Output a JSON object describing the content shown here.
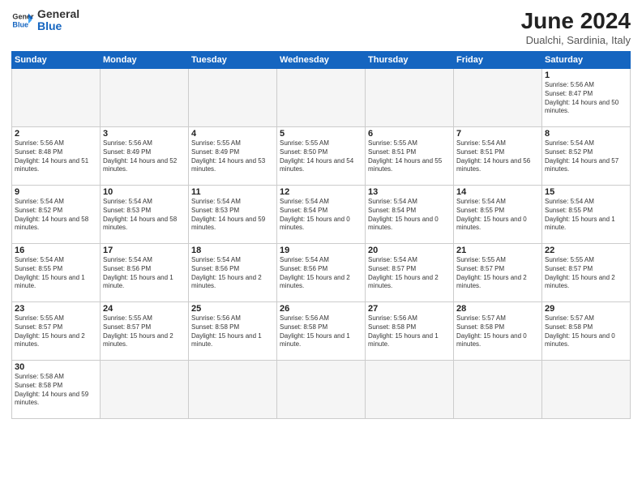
{
  "logo": {
    "text_general": "General",
    "text_blue": "Blue"
  },
  "header": {
    "title": "June 2024",
    "subtitle": "Dualchi, Sardinia, Italy"
  },
  "weekdays": [
    "Sunday",
    "Monday",
    "Tuesday",
    "Wednesday",
    "Thursday",
    "Friday",
    "Saturday"
  ],
  "weeks": [
    [
      {
        "day": "",
        "empty": true
      },
      {
        "day": "",
        "empty": true
      },
      {
        "day": "",
        "empty": true
      },
      {
        "day": "",
        "empty": true
      },
      {
        "day": "",
        "empty": true
      },
      {
        "day": "",
        "empty": true
      },
      {
        "day": "1",
        "sunrise": "5:56 AM",
        "sunset": "8:47 PM",
        "daylight": "14 hours and 50 minutes."
      }
    ],
    [
      {
        "day": "2",
        "sunrise": "5:56 AM",
        "sunset": "8:48 PM",
        "daylight": "14 hours and 51 minutes."
      },
      {
        "day": "3",
        "sunrise": "5:56 AM",
        "sunset": "8:49 PM",
        "daylight": "14 hours and 52 minutes."
      },
      {
        "day": "4",
        "sunrise": "5:55 AM",
        "sunset": "8:49 PM",
        "daylight": "14 hours and 53 minutes."
      },
      {
        "day": "5",
        "sunrise": "5:55 AM",
        "sunset": "8:50 PM",
        "daylight": "14 hours and 54 minutes."
      },
      {
        "day": "6",
        "sunrise": "5:55 AM",
        "sunset": "8:51 PM",
        "daylight": "14 hours and 55 minutes."
      },
      {
        "day": "7",
        "sunrise": "5:54 AM",
        "sunset": "8:51 PM",
        "daylight": "14 hours and 56 minutes."
      },
      {
        "day": "8",
        "sunrise": "5:54 AM",
        "sunset": "8:52 PM",
        "daylight": "14 hours and 57 minutes."
      }
    ],
    [
      {
        "day": "9",
        "sunrise": "5:54 AM",
        "sunset": "8:52 PM",
        "daylight": "14 hours and 58 minutes."
      },
      {
        "day": "10",
        "sunrise": "5:54 AM",
        "sunset": "8:53 PM",
        "daylight": "14 hours and 58 minutes."
      },
      {
        "day": "11",
        "sunrise": "5:54 AM",
        "sunset": "8:53 PM",
        "daylight": "14 hours and 59 minutes."
      },
      {
        "day": "12",
        "sunrise": "5:54 AM",
        "sunset": "8:54 PM",
        "daylight": "15 hours and 0 minutes."
      },
      {
        "day": "13",
        "sunrise": "5:54 AM",
        "sunset": "8:54 PM",
        "daylight": "15 hours and 0 minutes."
      },
      {
        "day": "14",
        "sunrise": "5:54 AM",
        "sunset": "8:55 PM",
        "daylight": "15 hours and 0 minutes."
      },
      {
        "day": "15",
        "sunrise": "5:54 AM",
        "sunset": "8:55 PM",
        "daylight": "15 hours and 1 minute."
      }
    ],
    [
      {
        "day": "16",
        "sunrise": "5:54 AM",
        "sunset": "8:55 PM",
        "daylight": "15 hours and 1 minute."
      },
      {
        "day": "17",
        "sunrise": "5:54 AM",
        "sunset": "8:56 PM",
        "daylight": "15 hours and 1 minute."
      },
      {
        "day": "18",
        "sunrise": "5:54 AM",
        "sunset": "8:56 PM",
        "daylight": "15 hours and 2 minutes."
      },
      {
        "day": "19",
        "sunrise": "5:54 AM",
        "sunset": "8:56 PM",
        "daylight": "15 hours and 2 minutes."
      },
      {
        "day": "20",
        "sunrise": "5:54 AM",
        "sunset": "8:57 PM",
        "daylight": "15 hours and 2 minutes."
      },
      {
        "day": "21",
        "sunrise": "5:55 AM",
        "sunset": "8:57 PM",
        "daylight": "15 hours and 2 minutes."
      },
      {
        "day": "22",
        "sunrise": "5:55 AM",
        "sunset": "8:57 PM",
        "daylight": "15 hours and 2 minutes."
      }
    ],
    [
      {
        "day": "23",
        "sunrise": "5:55 AM",
        "sunset": "8:57 PM",
        "daylight": "15 hours and 2 minutes."
      },
      {
        "day": "24",
        "sunrise": "5:55 AM",
        "sunset": "8:57 PM",
        "daylight": "15 hours and 2 minutes."
      },
      {
        "day": "25",
        "sunrise": "5:56 AM",
        "sunset": "8:58 PM",
        "daylight": "15 hours and 1 minute."
      },
      {
        "day": "26",
        "sunrise": "5:56 AM",
        "sunset": "8:58 PM",
        "daylight": "15 hours and 1 minute."
      },
      {
        "day": "27",
        "sunrise": "5:56 AM",
        "sunset": "8:58 PM",
        "daylight": "15 hours and 1 minute."
      },
      {
        "day": "28",
        "sunrise": "5:57 AM",
        "sunset": "8:58 PM",
        "daylight": "15 hours and 0 minutes."
      },
      {
        "day": "29",
        "sunrise": "5:57 AM",
        "sunset": "8:58 PM",
        "daylight": "15 hours and 0 minutes."
      }
    ],
    [
      {
        "day": "30",
        "sunrise": "5:58 AM",
        "sunset": "8:58 PM",
        "daylight": "14 hours and 59 minutes."
      },
      {
        "day": "",
        "empty": true
      },
      {
        "day": "",
        "empty": true
      },
      {
        "day": "",
        "empty": true
      },
      {
        "day": "",
        "empty": true
      },
      {
        "day": "",
        "empty": true
      },
      {
        "day": "",
        "empty": true
      }
    ]
  ]
}
